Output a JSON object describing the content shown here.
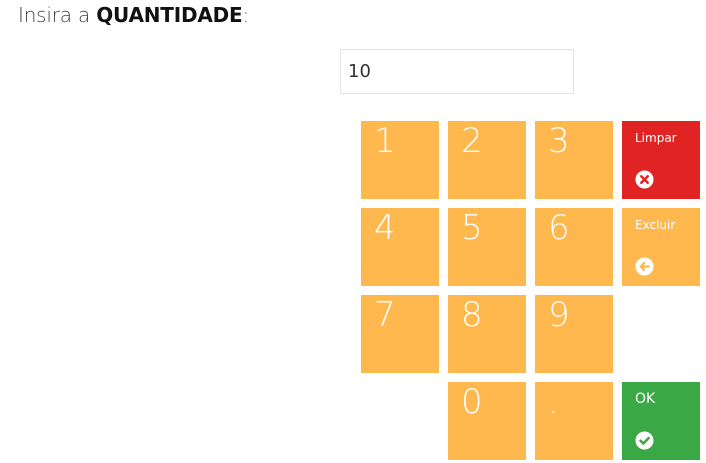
{
  "header": {
    "prefix": "Insira a",
    "emphasis": "QUANTIDADE",
    "suffix": ":"
  },
  "quantity_input": {
    "value": "10"
  },
  "keypad": {
    "digits": [
      "1",
      "2",
      "3",
      "4",
      "5",
      "6",
      "7",
      "8",
      "9",
      "0",
      "."
    ],
    "clear": {
      "label": "Limpar",
      "icon": "close-circle-icon",
      "color": "#e02424"
    },
    "delete": {
      "label": "Excluir",
      "icon": "arrow-left-circle-icon",
      "color": "#ffb84d"
    },
    "ok": {
      "label": "OK",
      "icon": "check-circle-icon",
      "color": "#3aa845"
    },
    "key_color": "#ffb84d"
  }
}
